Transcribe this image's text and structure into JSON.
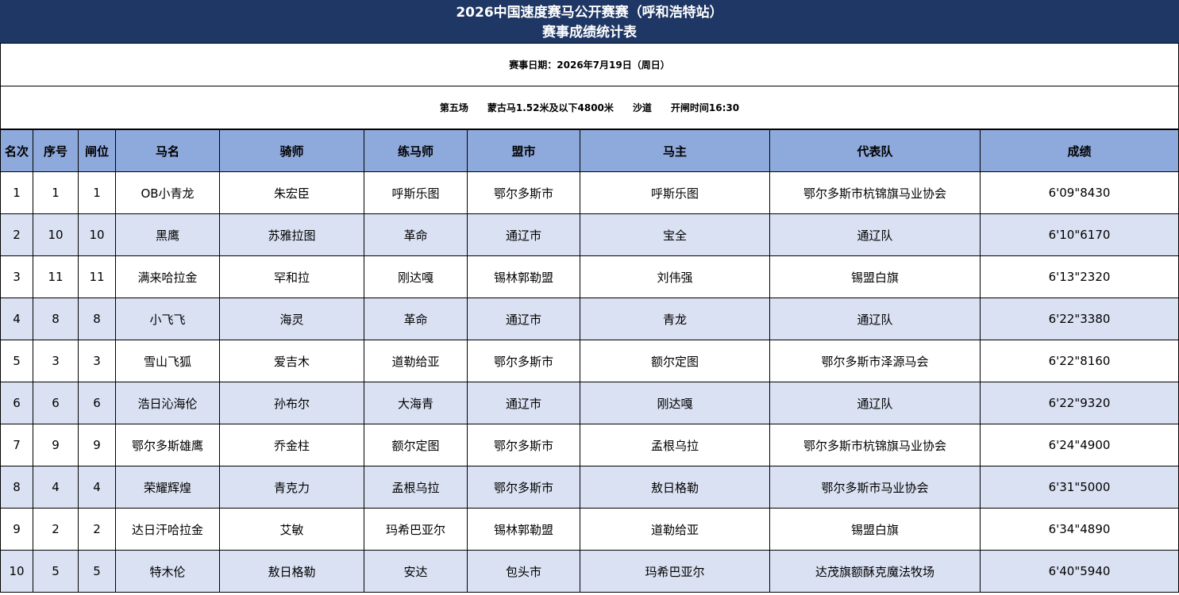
{
  "title": {
    "line1": "2026中国速度赛马公开赛赛（呼和浩特站）",
    "line2": "赛事成绩统计表"
  },
  "date_line": "赛事日期：2026年7月19日（周日）",
  "race_line": "第五场　　蒙古马1.52米及以下4800米　　沙道　　开闸时间16:30",
  "table": {
    "headers": [
      "名次",
      "序号",
      "闸位",
      "马名",
      "骑师",
      "练马师",
      "盟市",
      "马主",
      "代表队",
      "成绩"
    ],
    "rows": [
      [
        "1",
        "1",
        "1",
        "OB小青龙",
        "朱宏臣",
        "呼斯乐图",
        "鄂尔多斯市",
        "呼斯乐图",
        "鄂尔多斯市杭锦旗马业协会",
        "6'09\"8430"
      ],
      [
        "2",
        "10",
        "10",
        "黑鹰",
        "苏雅拉图",
        "革命",
        "通辽市",
        "宝全",
        "通辽队",
        "6'10\"6170"
      ],
      [
        "3",
        "11",
        "11",
        "满来哈拉金",
        "罕和拉",
        "刚达嘎",
        "锡林郭勒盟",
        "刘伟强",
        "锡盟白旗",
        "6'13\"2320"
      ],
      [
        "4",
        "8",
        "8",
        "小飞飞",
        "海灵",
        "革命",
        "通辽市",
        "青龙",
        "通辽队",
        "6'22\"3380"
      ],
      [
        "5",
        "3",
        "3",
        "雪山飞狐",
        "爱吉木",
        "道勒给亚",
        "鄂尔多斯市",
        "额尔定图",
        "鄂尔多斯市泽源马会",
        "6'22\"8160"
      ],
      [
        "6",
        "6",
        "6",
        "浩日沁海伦",
        "孙布尔",
        "大海青",
        "通辽市",
        "刚达嘎",
        "通辽队",
        "6'22\"9320"
      ],
      [
        "7",
        "9",
        "9",
        "鄂尔多斯雄鹰",
        "乔金柱",
        "额尔定图",
        "鄂尔多斯市",
        "孟根乌拉",
        "鄂尔多斯市杭锦旗马业协会",
        "6'24\"4900"
      ],
      [
        "8",
        "4",
        "4",
        "荣耀辉煌",
        "青克力",
        "孟根乌拉",
        "鄂尔多斯市",
        "敖日格勒",
        "鄂尔多斯市马业协会",
        "6'31\"5000"
      ],
      [
        "9",
        "2",
        "2",
        "达日汗哈拉金",
        "艾敏",
        "玛希巴亚尔",
        "锡林郭勒盟",
        "道勒给亚",
        "锡盟白旗",
        "6'34\"4890"
      ],
      [
        "10",
        "5",
        "5",
        "特木伦",
        "敖日格勒",
        "安达",
        "包头市",
        "玛希巴亚尔",
        "达茂旗额酥克魔法牧场",
        "6'40\"5940"
      ]
    ]
  },
  "colors": {
    "title_bg": "#1f3764",
    "header_bg": "#8ea9db",
    "alt_row_bg": "#d9e1f2"
  }
}
